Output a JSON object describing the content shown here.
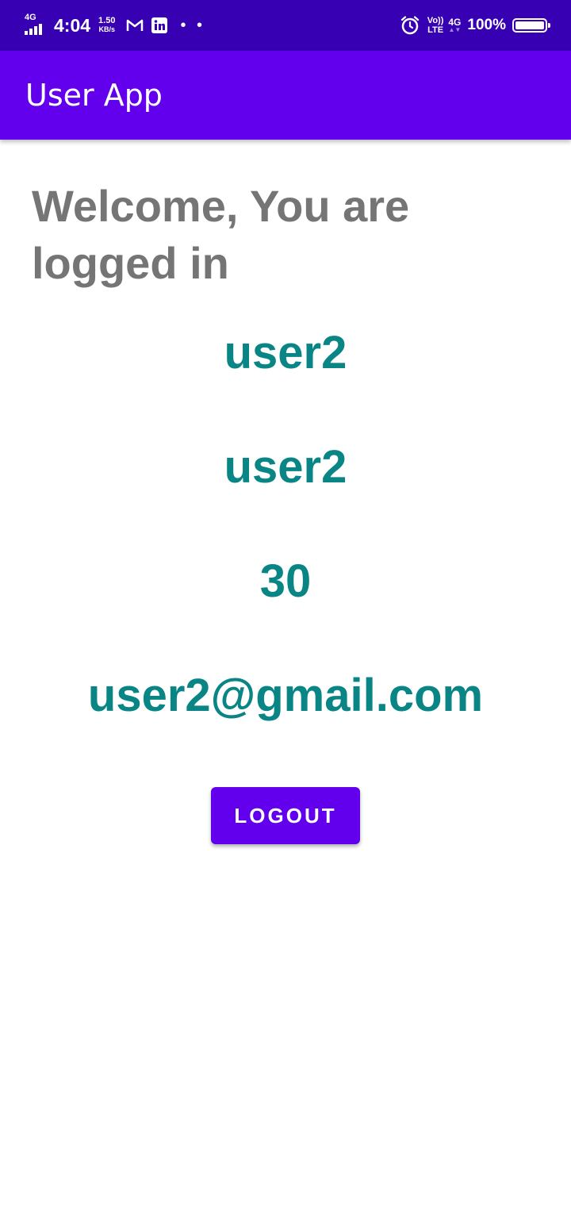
{
  "status_bar": {
    "network_type": "4G",
    "time": "4:04",
    "speed_value": "1.50",
    "speed_unit": "KB/s",
    "notification_icons": [
      "gmail-icon",
      "linkedin-icon"
    ],
    "more_notifications": "• •",
    "alarm_icon": "alarm-icon",
    "volte_top": "Vo))",
    "volte_bottom": "LTE",
    "data_network": "4G",
    "battery_percent": "100%",
    "battery_level": 1.0
  },
  "app_bar": {
    "title": "User App"
  },
  "main": {
    "welcome_text": "Welcome, You are logged in",
    "username": "user2",
    "name": "user2",
    "age": "30",
    "email": "user2@gmail.com",
    "logout_label": "LOGOUT"
  },
  "colors": {
    "status_bar": "#3700B3",
    "app_bar": "#6200EE",
    "welcome_text": "#757575",
    "info_text": "#0A8585",
    "button": "#6200EE"
  }
}
